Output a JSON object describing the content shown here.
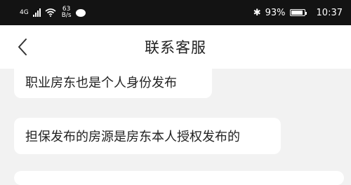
{
  "status_bar": {
    "network_type": "4G",
    "net_speed_value": "63",
    "net_speed_unit": "B/s",
    "battery_percent": "93%",
    "battery_level": 0.93,
    "time": "10:37"
  },
  "header": {
    "title": "联系客服",
    "back_icon": "chevron-left-icon"
  },
  "messages": [
    {
      "text": "职业房东也是个人身份发布"
    },
    {
      "text": "担保发布的房源是房东本人授权发布的"
    },
    {
      "text": ""
    }
  ],
  "colors": {
    "status_bar_bg": "#131313",
    "page_bg": "#f2f2f2",
    "bubble_bg": "#ffffff",
    "text": "#222222"
  }
}
